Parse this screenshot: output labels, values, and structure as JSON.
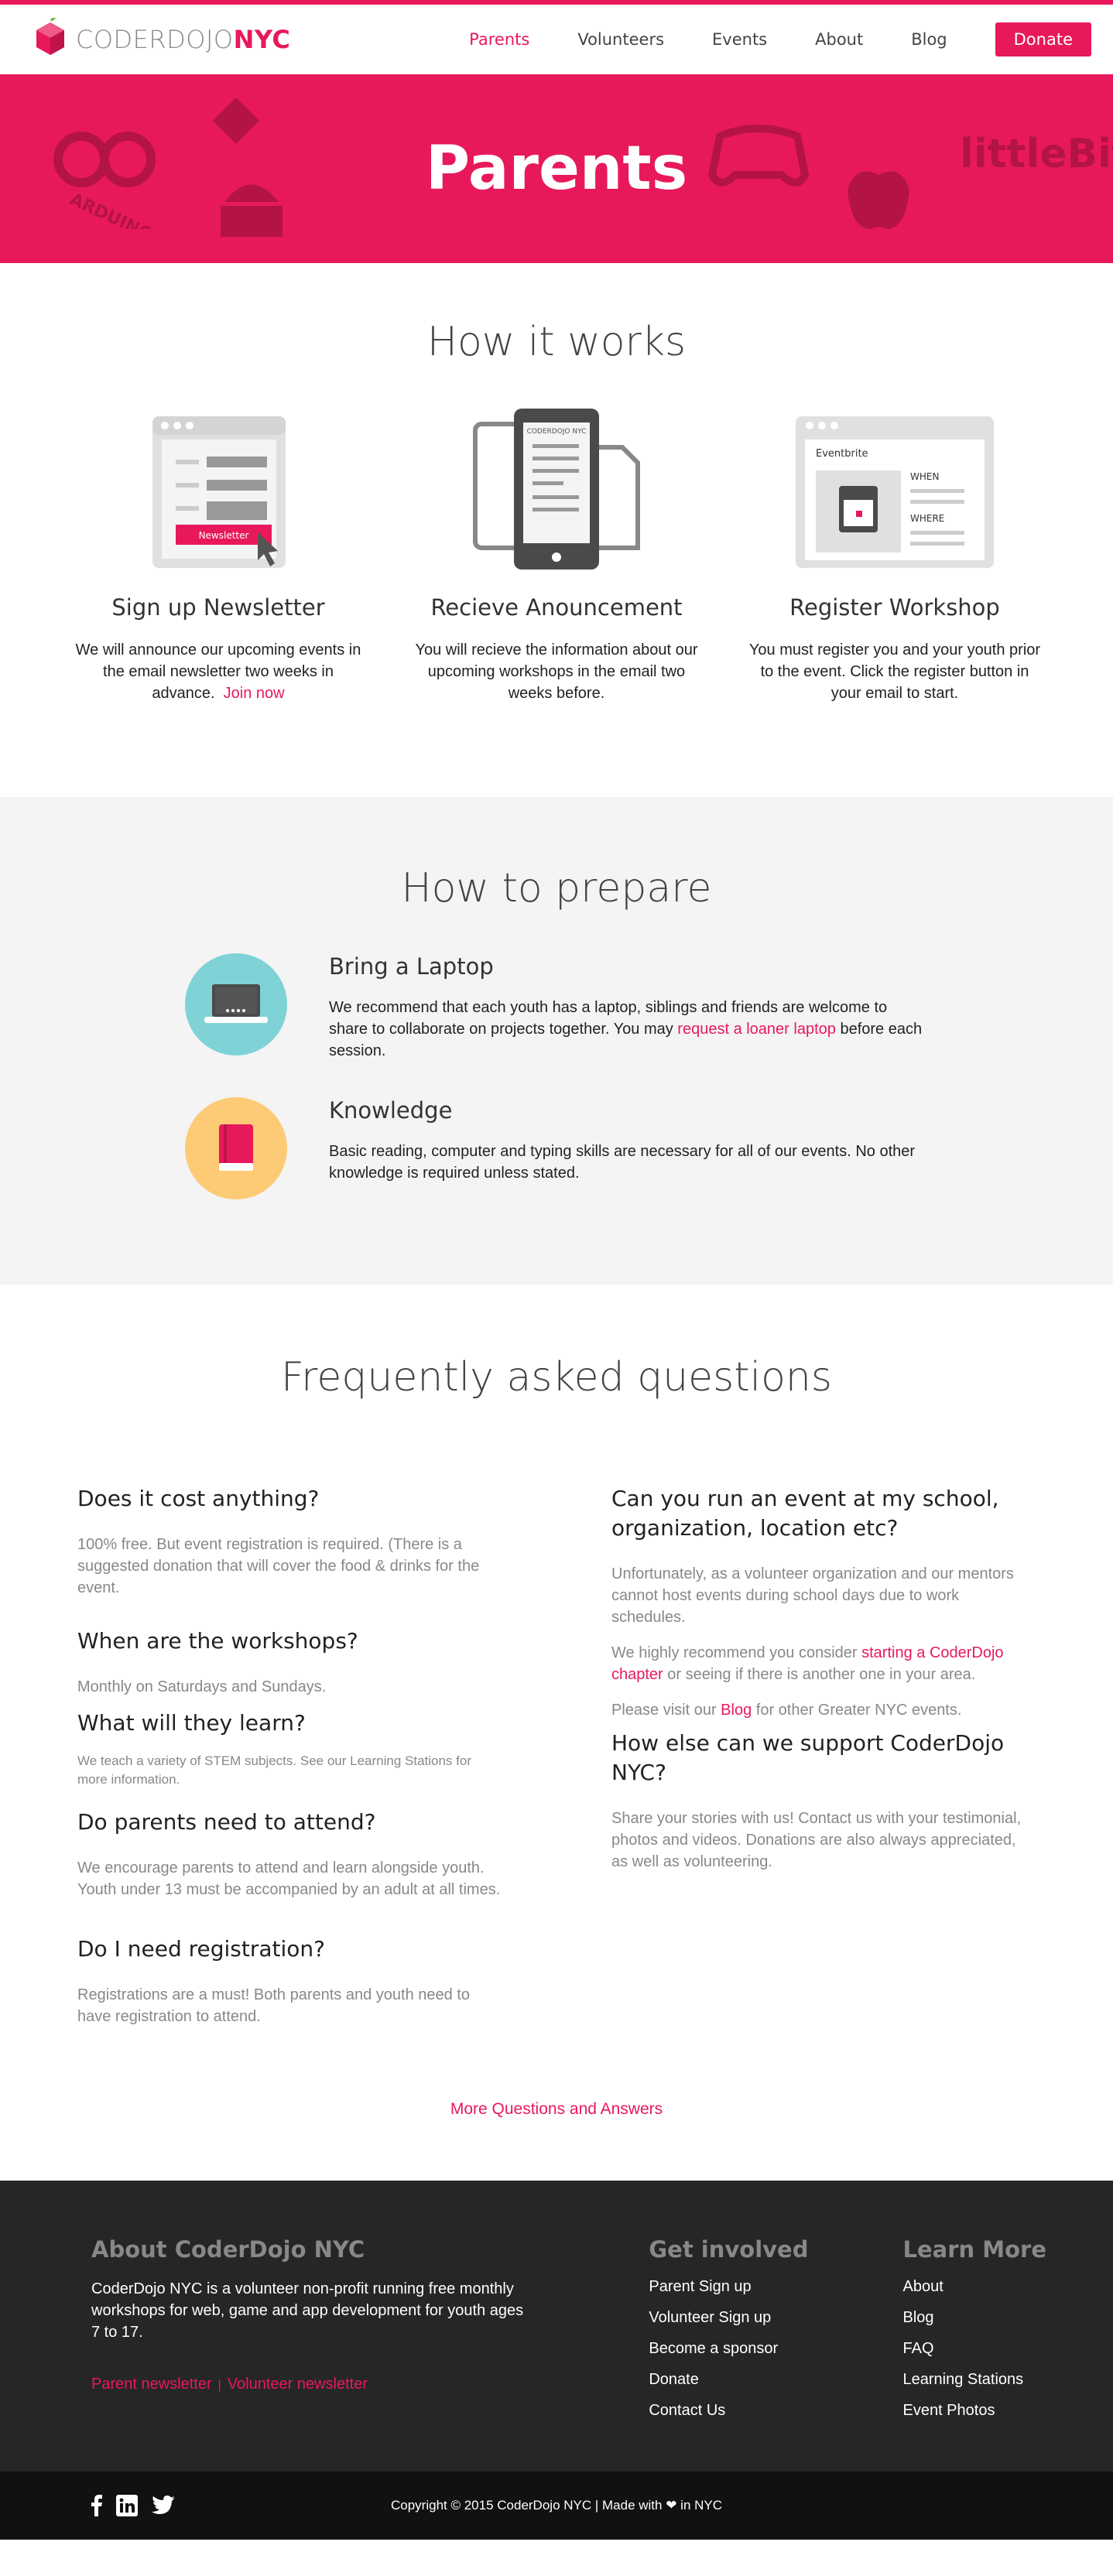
{
  "brand": {
    "logo_light": "CODERDOJO",
    "logo_bold": "NYC",
    "accent": "#e8195a"
  },
  "nav": [
    {
      "label": "Parents",
      "active": true
    },
    {
      "label": "Volunteers"
    },
    {
      "label": "Events"
    },
    {
      "label": "About"
    },
    {
      "label": "Blog"
    }
  ],
  "nav_donate": "Donate",
  "hero": {
    "title": "Parents",
    "bg_icons": [
      "arduino-icon",
      "raspberry-pi-icon",
      "android-icon",
      "gamepad-icon",
      "apple-icon"
    ],
    "littlebits": "littleBits",
    "arduino": "ARDUINO"
  },
  "how": {
    "title": "How it works",
    "steps": [
      {
        "title": "Sign up Newsletter",
        "text": "We will announce our upcoming events in the email newsletter two weeks in advance.",
        "link": "Join now",
        "illu_label": "Newsletter"
      },
      {
        "title": "Recieve Anouncement",
        "text": "You will recieve the information about our upcoming workshops in the email two weeks before.",
        "illu_label": "CODERDOJO NYC"
      },
      {
        "title": "Register Workshop",
        "text": "You must register you and your youth prior to the event. Click the register button in your email to start.",
        "illu_label": "Eventbrite",
        "illu_when": "WHEN",
        "illu_where": "WHERE"
      }
    ]
  },
  "prepare": {
    "title": "How to prepare",
    "items": [
      {
        "title": "Bring a Laptop",
        "text_before": "We recommend that each youth has a laptop, siblings and friends are welcome to share to collaborate on projects together. You may ",
        "link": "request a loaner laptop",
        "text_after": " before each session.",
        "color": "#7fd3d6"
      },
      {
        "title": "Knowledge",
        "text": "Basic reading, computer and typing skills are necessary for all of our events. No other knowledge is required unless stated.",
        "color": "#fdca75"
      }
    ]
  },
  "faq": {
    "title": "Frequently asked questions",
    "left": [
      {
        "q": "Does it cost anything?",
        "a": "100% free. But event registration is required. (There is a suggested donation that will cover the food & drinks for the event."
      },
      {
        "q": "When are the workshops?",
        "a": "Monthly on Saturdays and Sundays."
      },
      {
        "q": "What will they learn?",
        "a": "We teach a variety of STEM subjects. See our Learning Stations for more information."
      },
      {
        "q": "Do parents need to attend?",
        "a": "We encourage parents to attend and learn alongside youth. Youth under 13 must be accompanied by an adult at all times."
      },
      {
        "q": "Do I need registration?",
        "a": "Registrations are a must! Both parents and youth need to have registration to attend."
      }
    ],
    "right": {
      "q1": "Can you run an event at my school, organization, location etc?",
      "a1": "Unfortunately, as a volunteer organization and our mentors cannot host events during school days due to work schedules.",
      "a1b_before": "We highly recommend you consider ",
      "a1b_link": "starting a CoderDojo chapter",
      "a1b_after": " or seeing if there is another one in your area.",
      "a1c_before": "Please visit our ",
      "a1c_link": "Blog",
      "a1c_after": " for other Greater NYC events.",
      "q2": "How else can we support CoderDojo NYC?",
      "a2": "Share your stories with us! Contact us with your testimonial, photos and videos. Donations are also always appreciated, as well as volunteering."
    },
    "more": "More Questions and Answers"
  },
  "footer": {
    "about_title": "About CoderDojo NYC",
    "about_text": "CoderDojo NYC is a volunteer non-profit running free monthly workshops for web, game and app development for youth ages 7 to 17.",
    "parent_newsletter": "Parent newsletter",
    "sep": "|",
    "volunteer_newsletter": "Volunteer newsletter",
    "get_involved_title": "Get involved",
    "get_involved": [
      "Parent Sign up",
      "Volunteer Sign up",
      "Become a sponsor",
      "Donate",
      "Contact Us"
    ],
    "learn_more_title": "Learn More",
    "learn_more": [
      "About",
      "Blog",
      "FAQ",
      "Learning Stations",
      "Event Photos"
    ],
    "copyright": "Copyright © 2015 CoderDojo NYC | Made with ❤ in NYC"
  }
}
